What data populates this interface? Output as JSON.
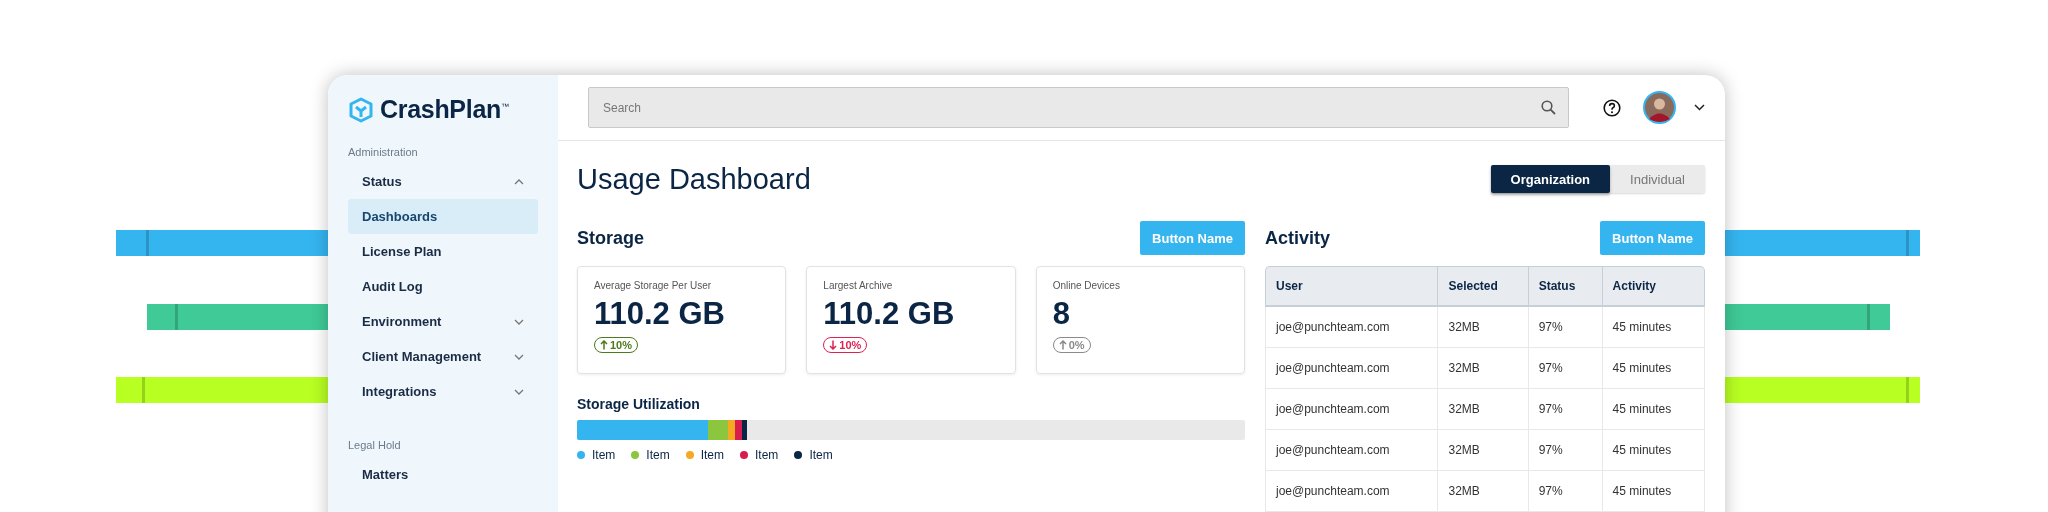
{
  "sidebar": {
    "logo": "CrashPlan$^{™}$",
    "sections": [
      {
        "heading": "Administration",
        "items": [
          {
            "label": "Status",
            "expanded": true,
            "selected": false,
            "children": [
              {
                "label": "Dashboards",
                "selected": true
              },
              {
                "label": "License Plan",
                "selected": false
              },
              {
                "label": "Audit Log",
                "selected": false
              }
            ]
          },
          {
            "label": "Environment",
            "expanded": false,
            "selected": false
          },
          {
            "label": "Client Management",
            "expanded": false,
            "selected": false
          },
          {
            "label": "Integrations",
            "expanded": false,
            "selected": false
          }
        ]
      },
      {
        "heading": "Legal Hold",
        "items": [
          {
            "label": "Matters",
            "selected": false
          }
        ]
      }
    ]
  },
  "header": {
    "search": {
      "placeholder": "Search"
    }
  },
  "page": {
    "title": "Usage Dashboard",
    "view_toggle": [
      {
        "label": "Organization",
        "selected": true
      },
      {
        "label": "Individual",
        "selected": false
      }
    ]
  },
  "storage": {
    "heading": "Storage",
    "button": "Button Name",
    "cards": [
      {
        "label": "Average Storage Per User",
        "value": "110.2 GB",
        "change": "10%",
        "kind": "up"
      },
      {
        "label": "Largest Archive",
        "value": "110.2 GB",
        "change": "10%",
        "kind": "down"
      },
      {
        "label": "Online Devices",
        "value": "8",
        "change": "0%",
        "kind": "neutral"
      }
    ],
    "utilization": {
      "heading": "Storage Utilization",
      "segments": [
        {
          "label": "Item",
          "color": "#35b5f0"
        },
        {
          "label": "Item",
          "color": "#8cc63f"
        },
        {
          "label": "Item",
          "color": "#f7a823"
        },
        {
          "label": "Item",
          "color": "#d91c4e"
        },
        {
          "label": "Item",
          "color": "#0b2545"
        }
      ]
    }
  },
  "activity": {
    "heading": "Activity",
    "button": "Button Name",
    "table": {
      "columns": [
        "User",
        "Selected",
        "Status",
        "Activity"
      ],
      "rows": [
        [
          "joe@punchteam.com",
          "32MB",
          "97%",
          "45 minutes"
        ],
        [
          "joe@punchteam.com",
          "32MB",
          "97%",
          "45 minutes"
        ],
        [
          "joe@punchteam.com",
          "32MB",
          "97%",
          "45 minutes"
        ],
        [
          "joe@punchteam.com",
          "32MB",
          "97%",
          "45 minutes"
        ],
        [
          "joe@punchteam.com",
          "32MB",
          "97%",
          "45 minutes"
        ]
      ]
    }
  }
}
